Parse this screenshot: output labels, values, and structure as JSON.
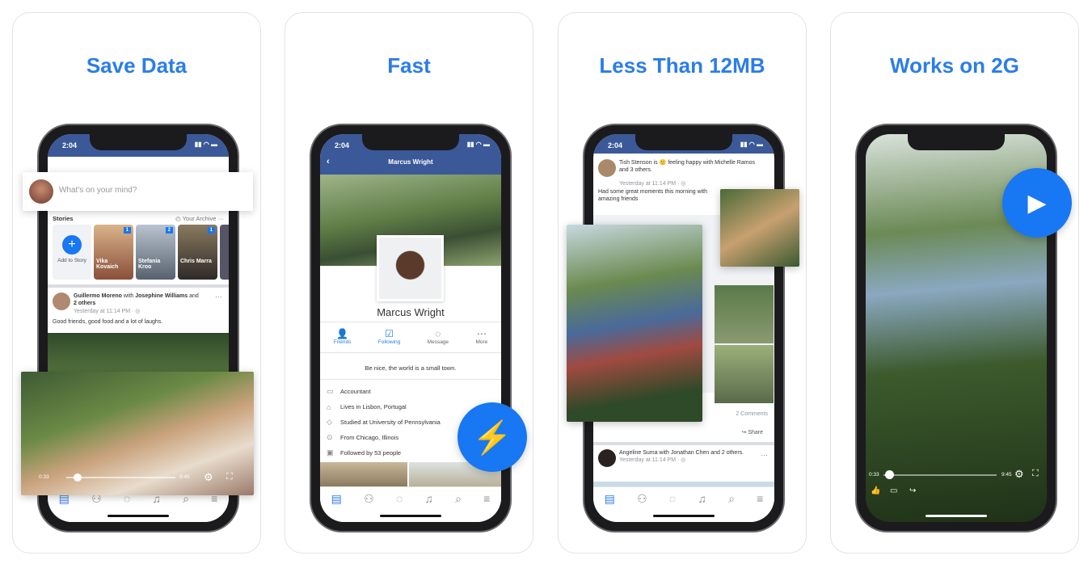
{
  "accent_color": "#2b7de9",
  "cards": [
    {
      "title": "Save Data",
      "status_time": "2:04",
      "composer_placeholder": "What's on your mind?",
      "stories_label": "Stories",
      "archive_label": "Your Archive",
      "add_story_label": "Add to Story",
      "stories": [
        {
          "name": "Vika Kovaich",
          "count": "1"
        },
        {
          "name": "Stefania Kroo",
          "count": "2"
        },
        {
          "name": "Chris Marra",
          "count": "1"
        }
      ],
      "post": {
        "author": "Guillermo Moreno",
        "with_word": "with",
        "tagged": "Josephine Williams",
        "and_word": "and",
        "others": "2 others",
        "timestamp": "Yesterday at 11:14 PM · ◎",
        "text": "Good friends, good food and a lot of laughs."
      },
      "video": {
        "elapsed": "0:33",
        "duration": "9:45",
        "progress": 0.1
      }
    },
    {
      "title": "Fast",
      "status_time": "2:04",
      "header_title": "Marcus Wright",
      "profile_name": "Marcus Wright",
      "actions": [
        "Friends",
        "Following",
        "Message",
        "More"
      ],
      "bio": "Be nice, the world is a small town.",
      "info": [
        "Accountant",
        "Lives in Lisbon, Portugal",
        "Studied at University of Pennsylvania",
        "From Chicago, Illinois",
        "Followed by 53 people"
      ],
      "badge_icon": "lightning-icon"
    },
    {
      "title": "Less Than 12MB",
      "status_time": "2:04",
      "post1": {
        "line1": "Tish Stenson is 🙂 feeling happy with Michelle Ramos and 3 others.",
        "timestamp": "Yesterday at 11:14 PM · ◎",
        "text": "Had some great moments this morning with amazing friends",
        "comments": "2 Comments",
        "share": "Share"
      },
      "post2": {
        "line1": "Angeline Suma with Jonathan Chen and 2 others.",
        "timestamp": "Yesterday at 11:14 PM · ◎"
      }
    },
    {
      "title": "Works on 2G",
      "video": {
        "elapsed": "0:33",
        "duration": "9:45",
        "progress": 0.05
      },
      "badge_icon": "play-icon"
    }
  ]
}
